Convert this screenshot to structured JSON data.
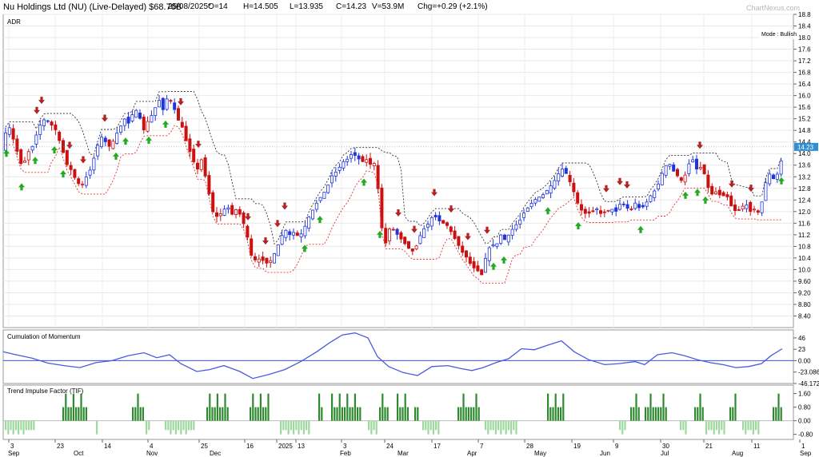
{
  "header": {
    "title": "Nu Holdings Ltd (NU) (Live-Delayed) $68.76B",
    "date": "25/08/2025*",
    "open": "O=14",
    "high": "H=14.505",
    "low": "L=13.935",
    "close": "C=14.23",
    "volume": "V=53.9M",
    "change": "Chg=+0.29 (+2.1%)",
    "brand": "ChartNexus.com"
  },
  "chart_data": [
    {
      "type": "candlestick",
      "panel": "price",
      "title": "ADR",
      "mode_label": "Mode : Bullish",
      "last_price_label": "14.23",
      "y_ticks": [
        "18.8",
        "18.4",
        "18.0",
        "17.6",
        "17.2",
        "16.8",
        "16.4",
        "16.0",
        "15.6",
        "15.2",
        "14.8",
        "14.4",
        "14.0",
        "13.6",
        "13.2",
        "12.8",
        "12.4",
        "12.0",
        "11.6",
        "11.2",
        "10.8",
        "10.4",
        "10.0",
        "9.60",
        "9.20",
        "8.80",
        "8.40"
      ],
      "ylim": [
        8.0,
        18.8
      ],
      "x_tick_labels": [
        "3",
        "23",
        "14",
        "4",
        "25",
        "16",
        "2025",
        "13",
        "3",
        "24",
        "17",
        "7",
        "28",
        "19",
        "9",
        "30",
        "21",
        "11",
        "1"
      ],
      "x_month_labels": [
        "Sep",
        "Oct",
        "Nov",
        "Dec",
        "Mar",
        "Feb",
        "Mar",
        "Apr",
        "May",
        "Jun",
        "Jul",
        "Aug",
        "Sep"
      ],
      "price_path": [
        [
          0,
          14.6
        ],
        [
          8,
          14.9
        ],
        [
          16,
          14.2
        ],
        [
          24,
          13.5
        ],
        [
          30,
          14.0
        ],
        [
          38,
          14.3
        ],
        [
          44,
          14.9
        ],
        [
          52,
          15.2
        ],
        [
          60,
          15.0
        ],
        [
          66,
          14.8
        ],
        [
          72,
          14.3
        ],
        [
          80,
          13.6
        ],
        [
          86,
          13.4
        ],
        [
          92,
          13.0
        ],
        [
          98,
          12.9
        ],
        [
          104,
          13.2
        ],
        [
          110,
          13.5
        ],
        [
          116,
          14.1
        ],
        [
          122,
          14.6
        ],
        [
          128,
          14.4
        ],
        [
          134,
          14.2
        ],
        [
          140,
          14.6
        ],
        [
          146,
          14.9
        ],
        [
          152,
          15.2
        ],
        [
          158,
          15.0
        ],
        [
          164,
          15.6
        ],
        [
          170,
          15.3
        ],
        [
          176,
          14.8
        ],
        [
          182,
          15.2
        ],
        [
          188,
          15.4
        ],
        [
          194,
          15.9
        ],
        [
          200,
          15.5
        ],
        [
          206,
          16.0
        ],
        [
          212,
          15.7
        ],
        [
          218,
          15.2
        ],
        [
          224,
          14.9
        ],
        [
          230,
          14.3
        ],
        [
          236,
          13.9
        ],
        [
          242,
          13.4
        ],
        [
          248,
          13.8
        ],
        [
          256,
          12.8
        ],
        [
          262,
          12.0
        ],
        [
          268,
          11.8
        ],
        [
          274,
          12.0
        ],
        [
          280,
          12.2
        ],
        [
          286,
          11.9
        ],
        [
          292,
          12.1
        ],
        [
          298,
          11.8
        ],
        [
          304,
          11.3
        ],
        [
          310,
          10.5
        ],
        [
          316,
          10.3
        ],
        [
          322,
          10.4
        ],
        [
          328,
          10.2
        ],
        [
          334,
          10.3
        ],
        [
          340,
          10.6
        ],
        [
          346,
          11.0
        ],
        [
          352,
          11.4
        ],
        [
          358,
          11.2
        ],
        [
          364,
          11.3
        ],
        [
          370,
          11.1
        ],
        [
          376,
          11.4
        ],
        [
          382,
          11.8
        ],
        [
          388,
          12.1
        ],
        [
          394,
          12.4
        ],
        [
          400,
          12.6
        ],
        [
          406,
          12.9
        ],
        [
          412,
          13.3
        ],
        [
          418,
          13.4
        ],
        [
          424,
          13.7
        ],
        [
          430,
          13.8
        ],
        [
          436,
          14.0
        ],
        [
          442,
          13.9
        ],
        [
          448,
          13.7
        ],
        [
          454,
          13.8
        ],
        [
          460,
          13.6
        ],
        [
          466,
          13.7
        ],
        [
          472,
          11.6
        ],
        [
          478,
          10.9
        ],
        [
          484,
          11.5
        ],
        [
          490,
          11.3
        ],
        [
          496,
          11.1
        ],
        [
          502,
          10.9
        ],
        [
          508,
          10.7
        ],
        [
          514,
          10.6
        ],
        [
          520,
          11.1
        ],
        [
          526,
          11.4
        ],
        [
          532,
          11.6
        ],
        [
          538,
          11.9
        ],
        [
          544,
          11.7
        ],
        [
          550,
          11.6
        ],
        [
          556,
          11.5
        ],
        [
          562,
          11.2
        ],
        [
          568,
          10.9
        ],
        [
          574,
          10.6
        ],
        [
          580,
          10.4
        ],
        [
          586,
          10.1
        ],
        [
          592,
          10.0
        ],
        [
          598,
          9.8
        ],
        [
          604,
          10.5
        ],
        [
          610,
          10.9
        ],
        [
          616,
          10.8
        ],
        [
          622,
          11.2
        ],
        [
          628,
          11.0
        ],
        [
          634,
          11.3
        ],
        [
          640,
          11.5
        ],
        [
          646,
          11.7
        ],
        [
          652,
          12.0
        ],
        [
          658,
          12.2
        ],
        [
          664,
          12.4
        ],
        [
          670,
          12.5
        ],
        [
          676,
          12.6
        ],
        [
          682,
          12.8
        ],
        [
          688,
          13.0
        ],
        [
          694,
          13.3
        ],
        [
          700,
          13.5
        ],
        [
          706,
          13.2
        ],
        [
          712,
          12.8
        ],
        [
          718,
          12.3
        ],
        [
          724,
          12.0
        ],
        [
          730,
          11.9
        ],
        [
          736,
          12.0
        ],
        [
          742,
          12.1
        ],
        [
          748,
          11.9
        ],
        [
          754,
          12.0
        ],
        [
          760,
          12.1
        ],
        [
          766,
          12.0
        ],
        [
          772,
          12.3
        ],
        [
          778,
          12.2
        ],
        [
          784,
          12.0
        ],
        [
          790,
          12.3
        ],
        [
          796,
          12.1
        ],
        [
          802,
          12.2
        ],
        [
          808,
          12.5
        ],
        [
          814,
          12.7
        ],
        [
          820,
          13.0
        ],
        [
          826,
          13.5
        ],
        [
          832,
          13.7
        ],
        [
          838,
          13.4
        ],
        [
          844,
          13.2
        ],
        [
          850,
          13.0
        ],
        [
          856,
          13.6
        ],
        [
          862,
          13.8
        ],
        [
          868,
          13.4
        ],
        [
          874,
          13.6
        ],
        [
          880,
          12.9
        ],
        [
          886,
          12.6
        ],
        [
          892,
          12.7
        ],
        [
          898,
          12.5
        ],
        [
          904,
          12.6
        ],
        [
          910,
          12.2
        ],
        [
          916,
          12.0
        ],
        [
          922,
          12.1
        ],
        [
          928,
          12.3
        ],
        [
          934,
          12.0
        ],
        [
          940,
          12.1
        ],
        [
          946,
          11.9
        ],
        [
          952,
          12.9
        ],
        [
          958,
          13.3
        ],
        [
          964,
          13.1
        ],
        [
          970,
          13.4
        ],
        [
          976,
          14.2
        ]
      ]
    },
    {
      "type": "line",
      "panel": "indicator",
      "title": "Cumulation of Momentum",
      "y_ticks": [
        "46",
        "23",
        "0.00",
        "-23.086",
        "-46.172"
      ],
      "ylim": [
        -46.172,
        62
      ]
    },
    {
      "type": "bar",
      "panel": "indicator",
      "title": "Trend Impulse Factor (TIF)",
      "y_ticks": [
        "1.60",
        "0.80",
        "0.00",
        "-0.80"
      ],
      "ylim": [
        -1.1,
        2.1
      ]
    }
  ]
}
